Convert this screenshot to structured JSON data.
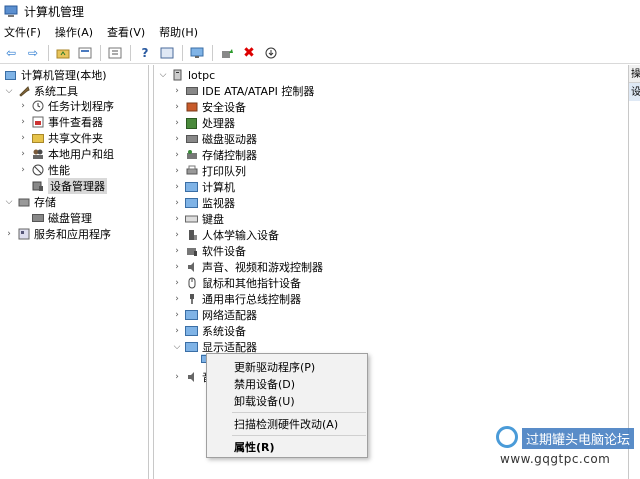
{
  "window": {
    "title": "计算机管理"
  },
  "menu": [
    "文件(F)",
    "操作(A)",
    "查看(V)",
    "帮助(H)"
  ],
  "toolbar": {
    "buttons": [
      "back-arrow-icon",
      "forward-arrow-icon",
      "folder-up-icon",
      "properties-icon",
      "console-tree-icon",
      "help-icon",
      "snapin-icon",
      "monitor-icon",
      "update-driver-icon",
      "uninstall-icon",
      "disable-icon"
    ]
  },
  "left_tree": {
    "root": "计算机管理(本地)",
    "system_tools": "系统工具",
    "task_scheduler": "任务计划程序",
    "event_viewer": "事件查看器",
    "shared_folders": "共享文件夹",
    "local_users": "本地用户和组",
    "performance": "性能",
    "device_manager": "设备管理器",
    "storage": "存储",
    "disk_management": "磁盘管理",
    "services_apps": "服务和应用程序"
  },
  "device_tree": {
    "computer": "lotpc",
    "items": [
      "IDE ATA/ATAPI 控制器",
      "安全设备",
      "处理器",
      "磁盘驱动器",
      "存储控制器",
      "打印队列",
      "计算机",
      "监视器",
      "键盘",
      "人体学输入设备",
      "软件设备",
      "声音、视频和游戏控制器",
      "鼠标和其他指针设备",
      "通用串行总线控制器",
      "网络适配器",
      "系统设备",
      "显示适配器"
    ],
    "partial_next": "音"
  },
  "context_menu": {
    "update_driver": "更新驱动程序(P)",
    "disable": "禁用设备(D)",
    "uninstall": "卸载设备(U)",
    "scan": "扫描检测硬件改动(A)",
    "properties": "属性(R)"
  },
  "right_panel": {
    "header": "操",
    "sub": "设"
  },
  "watermark": {
    "title": "过期罐头电脑论坛",
    "url": "www.gqgtpc.com"
  }
}
